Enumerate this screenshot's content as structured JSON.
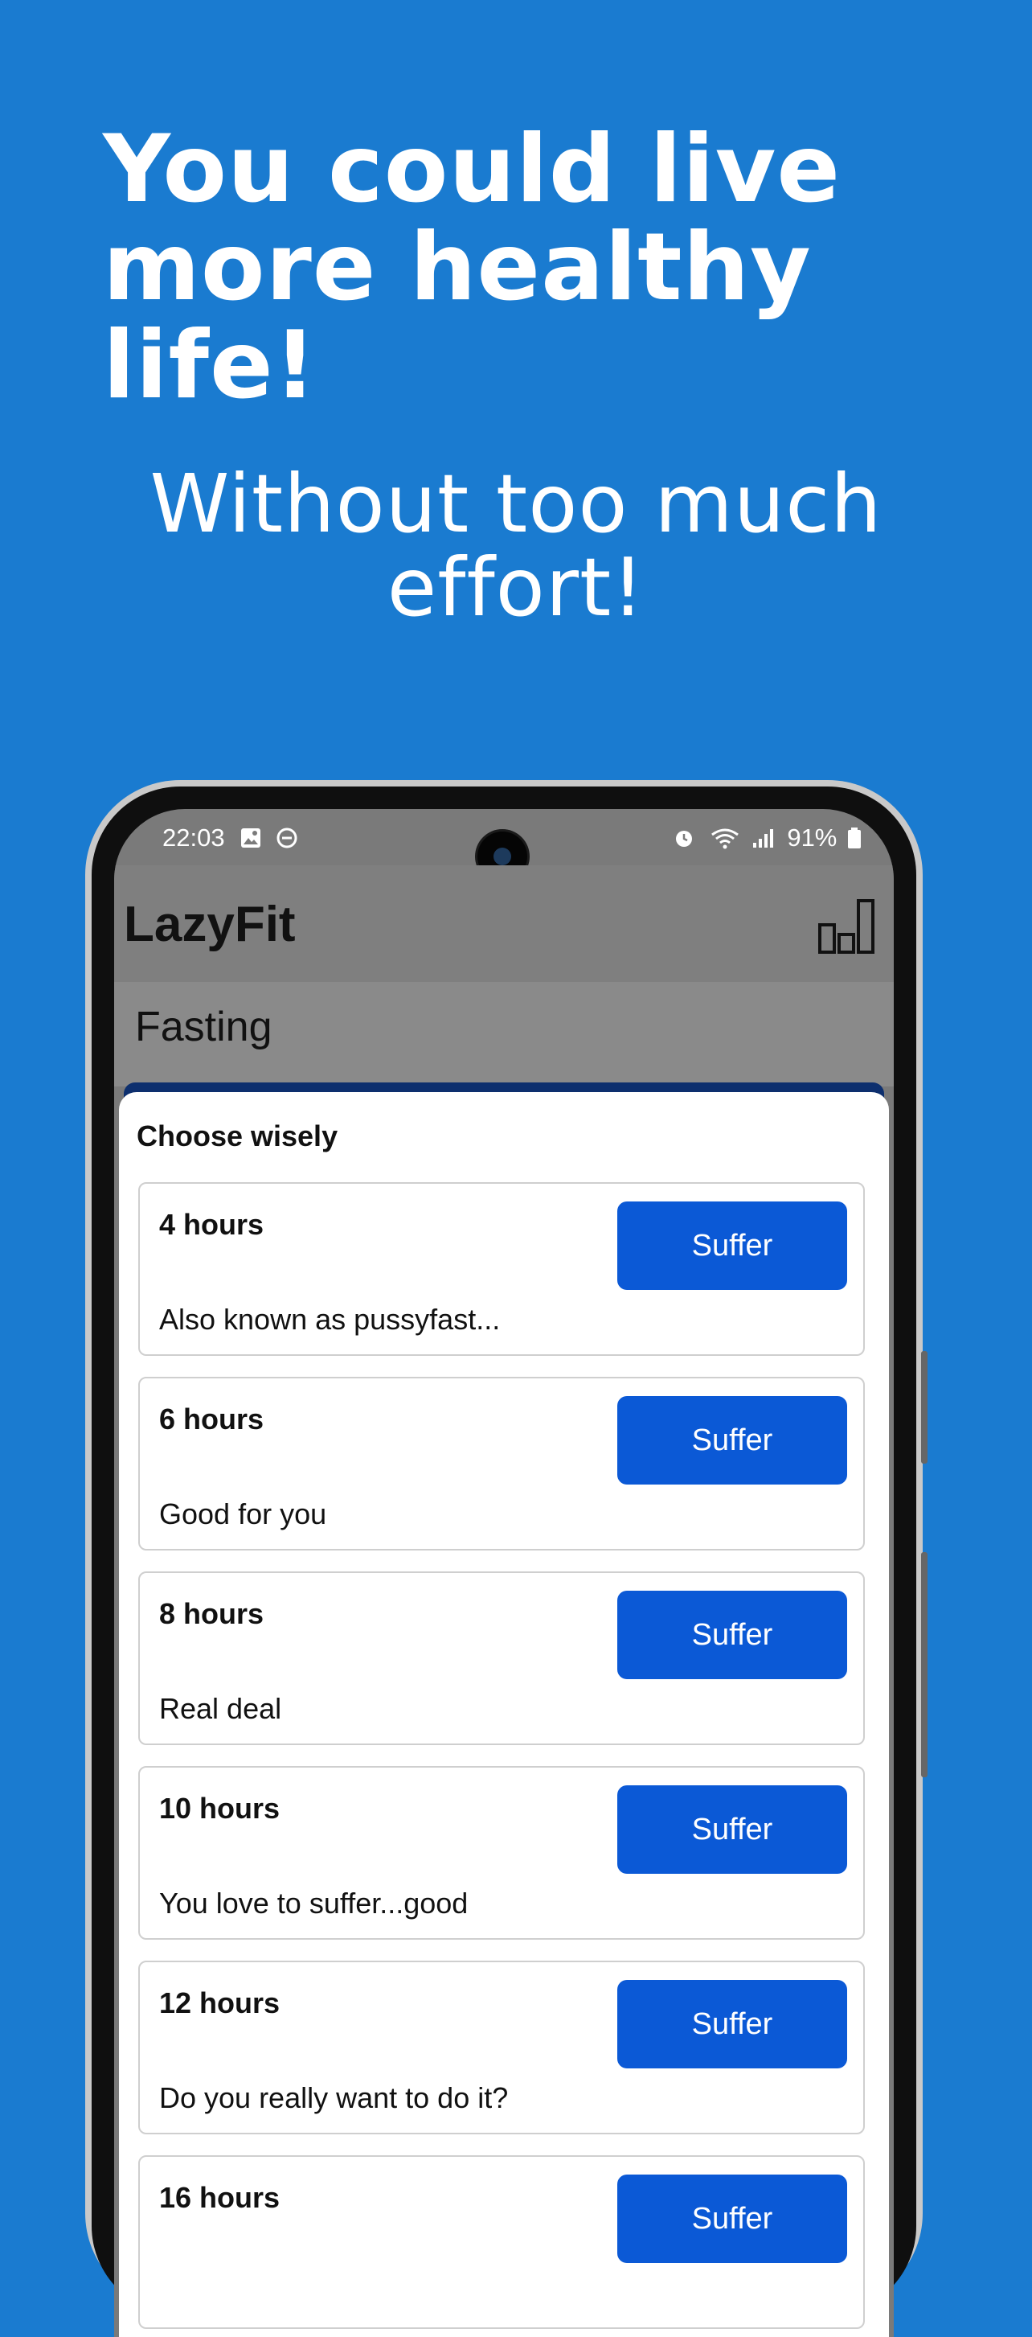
{
  "promo": {
    "headline_line1": "You could live",
    "headline_line2": "more healthy life!",
    "subhead_line1": "Without too much",
    "subhead_line2": "effort!"
  },
  "status_bar": {
    "time": "22:03",
    "battery": "91%"
  },
  "app_bar": {
    "title": "LazyFit",
    "stats_icon": "bar-chart-icon"
  },
  "section": {
    "title": "Fasting"
  },
  "sheet": {
    "title": "Choose wisely",
    "options": [
      {
        "hours": "4 hours",
        "description": "Also known as pussyfast...",
        "button": "Suffer"
      },
      {
        "hours": "6 hours",
        "description": "Good for you",
        "button": "Suffer"
      },
      {
        "hours": "8 hours",
        "description": "Real deal",
        "button": "Suffer"
      },
      {
        "hours": "10 hours",
        "description": "You love to suffer...good",
        "button": "Suffer"
      },
      {
        "hours": "12 hours",
        "description": "Do you really want to do it?",
        "button": "Suffer"
      },
      {
        "hours": "16 hours",
        "description": "",
        "button": "Suffer"
      }
    ]
  },
  "colors": {
    "background": "#1a7bd0",
    "button": "#0b59d6"
  }
}
